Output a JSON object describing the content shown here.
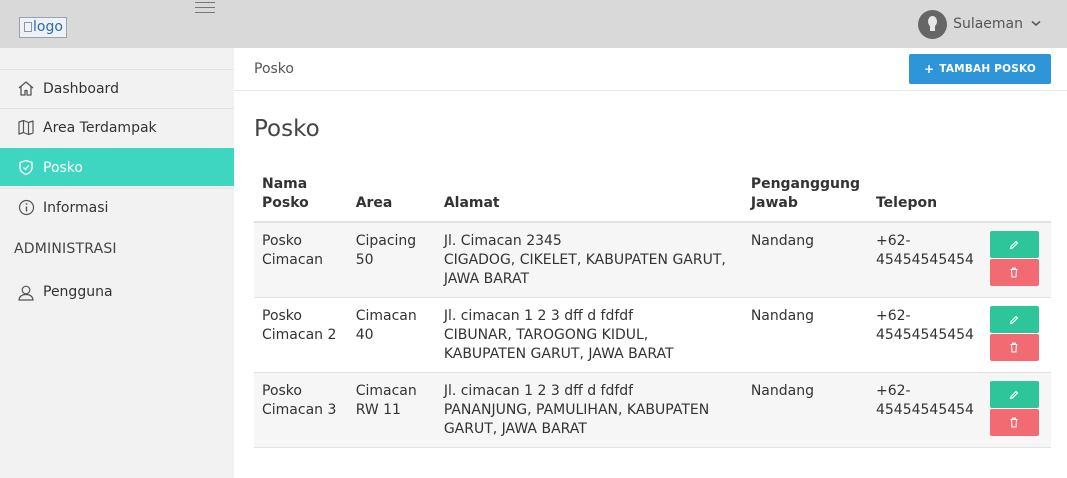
{
  "header": {
    "logo_alt": "logo",
    "user_name": "Sulaeman"
  },
  "sidebar": {
    "items": [
      {
        "label": "Dashboard",
        "icon": "home-icon"
      },
      {
        "label": "Area Terdampak",
        "icon": "map-icon"
      },
      {
        "label": "Posko",
        "icon": "shield-icon",
        "active": true
      },
      {
        "label": "Informasi",
        "icon": "info-icon"
      }
    ],
    "section_admin": "ADMINISTRASI",
    "admin_items": [
      {
        "label": "Pengguna",
        "icon": "user-icon"
      }
    ]
  },
  "main": {
    "breadcrumb": "Posko",
    "add_button": "TAMBAH POSKO",
    "title": "Posko",
    "table": {
      "headers": {
        "nama": "Nama Posko",
        "area": "Area",
        "alamat": "Alamat",
        "pj": "Penganggung Jawab",
        "telepon": "Telepon"
      },
      "rows": [
        {
          "nama": "Posko Cimacan",
          "area": "Cipacing 50",
          "alamat_1": "Jl. Cimacan 2345",
          "alamat_2": "CIGADOG, CIKELET, KABUPATEN GARUT, JAWA BARAT",
          "pj": "Nandang",
          "telepon": "+62-45454545454"
        },
        {
          "nama": "Posko Cimacan 2",
          "area": "Cimacan 40",
          "alamat_1": "Jl. cimacan 1 2 3 dff d fdfdf",
          "alamat_2": "CIBUNAR, TAROGONG KIDUL, KABUPATEN GARUT, JAWA BARAT",
          "pj": "Nandang",
          "telepon": "+62-45454545454"
        },
        {
          "nama": "Posko Cimacan 3",
          "area": "Cimacan RW 11",
          "alamat_1": "Jl. cimacan 1 2 3 dff d fdfdf",
          "alamat_2": "PANANJUNG, PAMULIHAN, KABUPATEN GARUT, JAWA BARAT",
          "pj": "Nandang",
          "telepon": "+62-45454545454"
        }
      ]
    }
  },
  "colors": {
    "active_sidebar": "#3ed6c0",
    "primary_button": "#2e95d8",
    "edit_button": "#2fc59a",
    "delete_button": "#f26b73"
  }
}
